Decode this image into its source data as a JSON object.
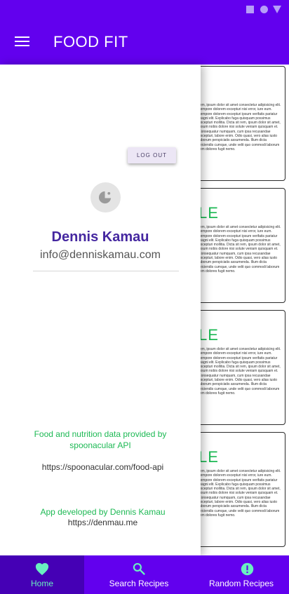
{
  "app": {
    "title": "FOOD FIT"
  },
  "drawer": {
    "logout_label": "LOG OUT",
    "user_name": "Dennis Kamau",
    "user_email": "info@denniskamau.com",
    "credit": "Food and nutrition data provided by spoonacular API",
    "api_url": "https://spoonacular.com/food-api",
    "developer": "App developed by Dennis Kamau",
    "developer_url": "https://denmau.me"
  },
  "cards": [
    {
      "title": "",
      "text": "rem, ipsum dolor sit amet consectetur adipisicing elit. Tempore dolorem excepturi nisi error, iure eum. Tempore dolorem excepturi ipsum verifatis pariatur magni elit. Explicabo fuga quisquam possimus excepturi mollitia. Dicta sit rem, ipsum dolor sit amet, Ipsum nobis dolore nisi solute veniam quisquam et. Consequatur numquam, cum ipsa recusandae excepturi, labore enim. Odio quasi, vero alias iusto laborum perspiciatis assumenda. Illum dicta reiciendis cumque, unde velit quo commodi laborum rem dolores fugit nemo."
    },
    {
      "title": "LE",
      "text": "rem, ipsum dolor sit amet consectetur adipisicing elit. Tempore dolorem excepturi nisi error, iure eum. Tempore dolorem excepturi ipsum verifatis pariatur magni elit. Explicabo fuga quisquam possimus excepturi mollitia. Dicta sit rem, ipsum dolor sit amet, Ipsum nobis dolore nisi solute veniam quisquam et. Consequatur numquam, cum ipsa recusandae excepturi, labore enim. Odio quasi, vero alias iusto laborum perspiciatis assumenda. Illum dicta reiciendis cumque, unde velit quo commodi laborum rem dolores fugit nemo."
    },
    {
      "title": "LE",
      "text": "rem, ipsum dolor sit amet consectetur adipisicing elit. Tempore dolorem excepturi nisi error, iure eum. Tempore dolorem excepturi ipsum verifatis pariatur magni elit. Explicabo fuga quisquam possimus excepturi mollitia. Dicta sit rem, ipsum dolor sit amet, Ipsum nobis dolore nisi solute veniam quisquam et. Consequatur numquam, cum ipsa recusandae excepturi, labore enim. Odio quasi, vero alias iusto laborum perspiciatis assumenda. Illum dicta reiciendis cumque, unde velit quo commodi laborum rem dolores fugit nemo."
    },
    {
      "title": "LE",
      "text": "rem, ipsum dolor sit amet consectetur adipisicing elit. Tempore dolorem excepturi nisi error, iure eum. Tempore dolorem excepturi ipsum verifatis pariatur magni elit. Explicabo fuga quisquam possimus excepturi mollitia. Dicta sit rem, ipsum dolor sit amet, Ipsum nobis dolore nisi solute veniam quisquam et. Consequatur numquam, cum ipsa recusandae excepturi, labore enim. Odio quasi, vero alias iusto laborum perspiciatis assumenda. Illum dicta reiciendis cumque, unde velit quo commodi laborum rem dolores fugit nemo."
    }
  ],
  "bottom_nav": [
    {
      "label": "Home",
      "icon": "heart-icon",
      "active": true
    },
    {
      "label": "Search Recipes",
      "icon": "search-icon",
      "active": false
    },
    {
      "label": "Random Recipes",
      "icon": "alert-circle-icon",
      "active": false
    }
  ],
  "colors": {
    "primary": "#6200ee",
    "nav_active": "#4500b5",
    "accent_green": "#1db954",
    "name_purple": "#4527a0",
    "mint": "#69f0c0"
  }
}
